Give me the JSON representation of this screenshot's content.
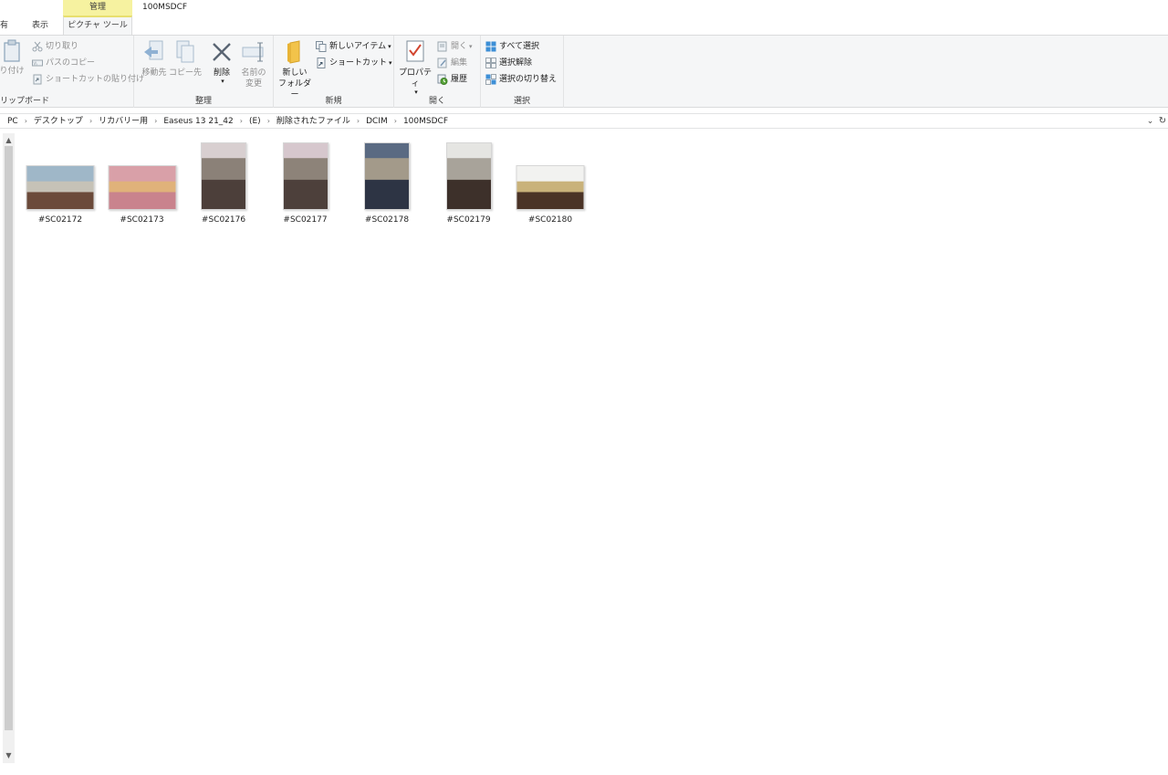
{
  "window": {
    "title": "100MSDCF"
  },
  "tabs": {
    "share": "有",
    "view": "表示",
    "context_header": "管理",
    "context_tab": "ピクチャ ツール"
  },
  "ribbon": {
    "clipboard": {
      "paste": "り付け",
      "cut": "切り取り",
      "copy_path": "パスのコピー",
      "paste_shortcut": "ショートカットの貼り付け",
      "label": "リップボード"
    },
    "organize": {
      "move_to": "移動先",
      "copy_to": "コピー先",
      "delete": "削除",
      "rename_line1": "名前の",
      "rename_line2": "変更",
      "label": "整理"
    },
    "new": {
      "new_folder_line1": "新しい",
      "new_folder_line2": "フォルダー",
      "new_item": "新しいアイテム",
      "shortcut": "ショートカット",
      "label": "新規"
    },
    "open": {
      "properties": "プロパティ",
      "open": "開く",
      "edit": "編集",
      "history": "履歴",
      "label": "開く"
    },
    "select": {
      "select_all": "すべて選択",
      "select_none": "選択解除",
      "invert": "選択の切り替え",
      "label": "選択"
    }
  },
  "address": {
    "crumbs": [
      "PC",
      "デスクトップ",
      "リカバリー用",
      "Easeus 13 21_42",
      "(E)",
      "削除されたファイル",
      "DCIM",
      "100MSDCF"
    ]
  },
  "files": [
    {
      "name": "#SC02172",
      "orientation": "landscape",
      "colors": [
        "#9fb7c8",
        "#6b4a3a",
        "#c6c2b7"
      ]
    },
    {
      "name": "#SC02173",
      "orientation": "landscape",
      "colors": [
        "#d9a0a8",
        "#c9838d",
        "#e0b27a"
      ]
    },
    {
      "name": "#SC02176",
      "orientation": "portrait",
      "colors": [
        "#d8cfd0",
        "#4c3f3a",
        "#8b8178"
      ]
    },
    {
      "name": "#SC02177",
      "orientation": "portrait",
      "colors": [
        "#d6c7cd",
        "#4d403b",
        "#8d8379"
      ]
    },
    {
      "name": "#SC02178",
      "orientation": "portrait",
      "colors": [
        "#5a6a82",
        "#2d3444",
        "#a39a8a"
      ]
    },
    {
      "name": "#SC02179",
      "orientation": "portrait",
      "colors": [
        "#e5e5e2",
        "#3d302a",
        "#a8a39a"
      ]
    },
    {
      "name": "#SC02180",
      "orientation": "landscape",
      "colors": [
        "#f2f2f0",
        "#4a3326",
        "#c9b27a"
      ]
    }
  ]
}
